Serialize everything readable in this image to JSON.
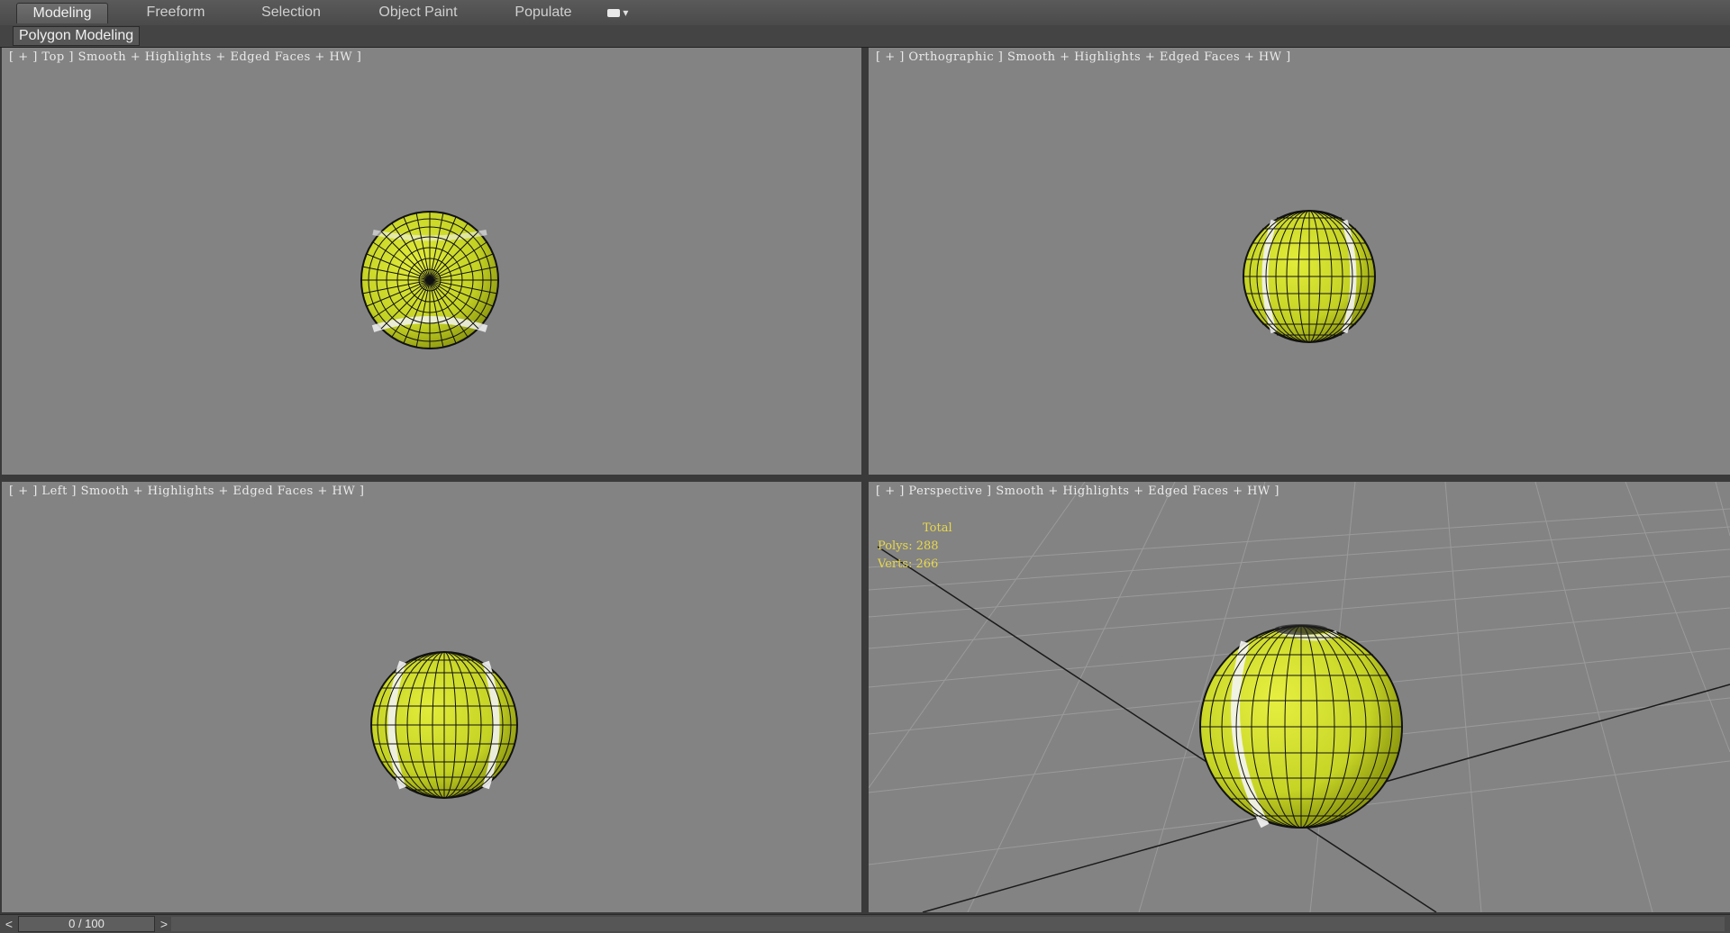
{
  "ribbon": {
    "tabs": [
      {
        "label": "Modeling",
        "active": true
      },
      {
        "label": "Freeform",
        "active": false
      },
      {
        "label": "Selection",
        "active": false
      },
      {
        "label": "Object Paint",
        "active": false
      },
      {
        "label": "Populate",
        "active": false
      }
    ],
    "extra_button_icon": "dropdown-box-icon"
  },
  "subbar": {
    "panel_label": "Polygon Modeling"
  },
  "viewports": {
    "top": {
      "label": "[ + ] Top ] Smooth + Highlights + Edged Faces + HW ]"
    },
    "orthographic": {
      "label": "[ + ] Orthographic ] Smooth + Highlights + Edged Faces + HW ]"
    },
    "left": {
      "label": "[ + ] Left ] Smooth + Highlights + Edged Faces + HW ]"
    },
    "perspective": {
      "label": "[ + ] Perspective ] Smooth + Highlights + Edged Faces + HW ]",
      "stats": {
        "title": "Total",
        "polys": "Polys: 288",
        "verts": "Verts: 266"
      }
    }
  },
  "timeline": {
    "prev": "<",
    "frame": "0 / 100",
    "next": ">"
  },
  "colors": {
    "viewport_bg": "#838383",
    "ball": "#c8d628",
    "stats_text": "#e8d84a"
  }
}
